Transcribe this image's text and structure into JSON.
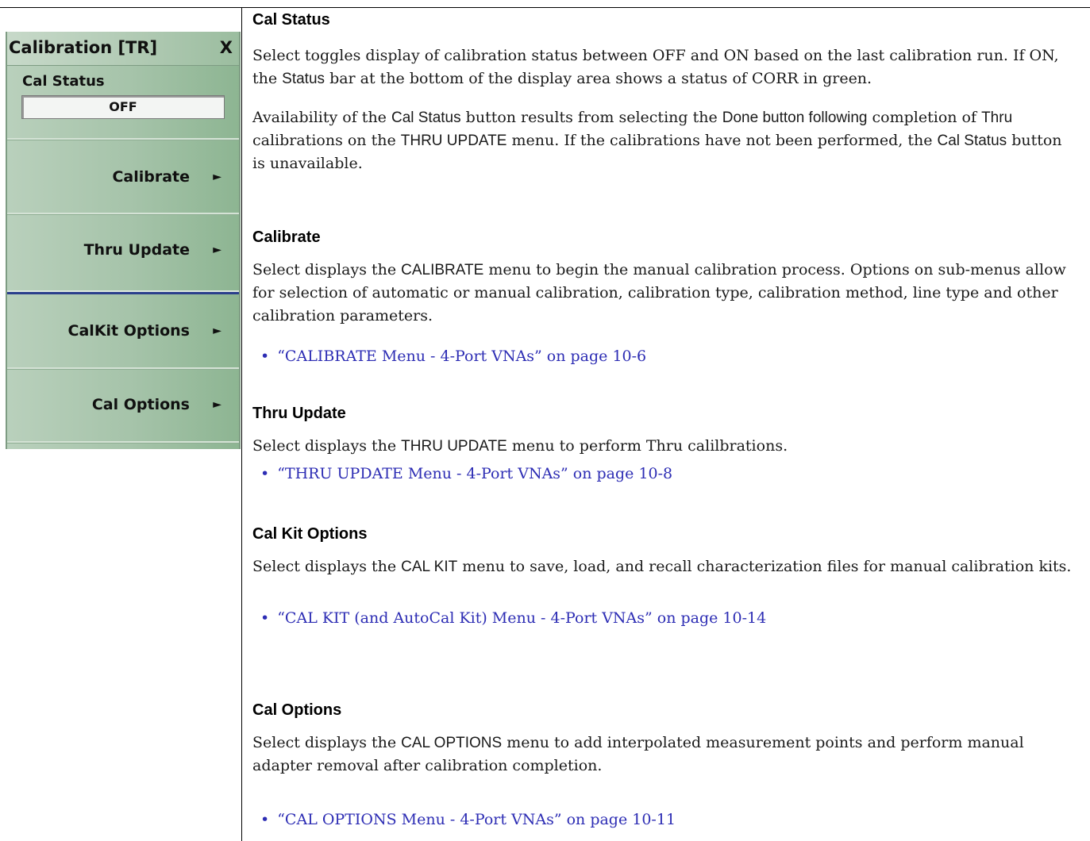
{
  "menu": {
    "title": "Calibration [TR]",
    "close_label": "X",
    "status_label": "Cal Status",
    "status_value": "OFF",
    "buttons": [
      {
        "label": "Calibrate",
        "arrow": "►"
      },
      {
        "label": "Thru Update",
        "arrow": "►"
      },
      {
        "label": "CalKit Options",
        "arrow": "►"
      },
      {
        "label": "Cal Options",
        "arrow": "►"
      }
    ]
  },
  "sections": {
    "cal_status": {
      "heading": "Cal Status",
      "p1": {
        "a": "Select toggles display of calibration status between OFF and ON based on the last calibration run. If ON, the ",
        "b": "Status",
        "c": " bar at the bottom of the display area shows a status of CORR in green."
      },
      "p2": {
        "a": "Availability of the ",
        "b": "Cal Status",
        "c": " button results from selecting the ",
        "d": "Done button following",
        "e": " completion of ",
        "f": "Thru",
        "g": " calibrations on the ",
        "h": "THRU UPDATE",
        "i": " menu. If the calibrations have not been performed, the ",
        "j": "Cal Status",
        "k": " button is unavailable."
      }
    },
    "calibrate": {
      "heading": "Calibrate",
      "p": {
        "a": "Select displays the ",
        "b": "CALIBRATE",
        "c": " menu to begin the manual calibration process. Options on sub-menus allow for selection of automatic or manual calibration, calibration type, calibration method, line type and other calibration parameters."
      },
      "link": "“CALIBRATE Menu - 4-Port VNAs” on page 10-6"
    },
    "thru_update": {
      "heading": "Thru Update",
      "p": {
        "a": "Select displays the ",
        "b": "THRU UPDATE",
        "c": " menu to perform Thru calilbrations."
      },
      "link": "“THRU UPDATE Menu - 4-Port VNAs” on page 10-8"
    },
    "cal_kit": {
      "heading": "Cal Kit Options",
      "p": {
        "a": "Select displays the ",
        "b": "CAL KIT",
        "c": " menu to save, load, and recall characterization files for manual calibration kits."
      },
      "link": "“CAL KIT (and AutoCal Kit) Menu - 4-Port VNAs” on page 10-14"
    },
    "cal_options": {
      "heading": "Cal Options",
      "p": {
        "a": "Select displays the ",
        "b": "CAL OPTIONS",
        "c": " menu to add interpolated measurement points and perform manual adapter removal after calibration completion."
      },
      "link": "“CAL OPTIONS Menu - 4-Port VNAs” on page 10-11"
    }
  },
  "bullet_glyph": "•",
  "colors": {
    "link": "#2d2db4",
    "panel": "#a5c3a9",
    "separator": "#2b3f8c"
  }
}
